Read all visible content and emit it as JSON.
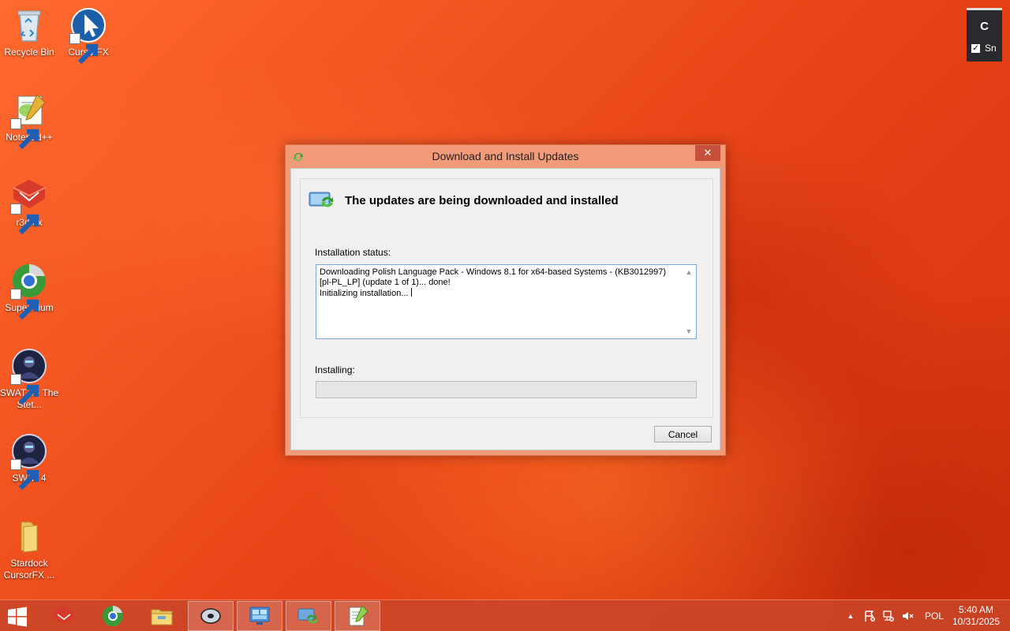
{
  "desktop": {
    "icons": [
      {
        "label": "Recycle Bin",
        "icon": "recycle-bin-icon"
      },
      {
        "label": "CursorFX",
        "icon": "cursorfx-icon"
      },
      {
        "label": "Notepad++",
        "icon": "notepadpp-icon"
      },
      {
        "label": "r3dfox",
        "icon": "r3dfox-icon"
      },
      {
        "label": "Supermium",
        "icon": "supermium-icon"
      },
      {
        "label": "SWAT 4 - The Stet...",
        "icon": "swat4-icon"
      },
      {
        "label": "SWAT 4",
        "icon": "swat4-icon"
      },
      {
        "label": "Stardock CursorFX ...",
        "icon": "folder-icon"
      }
    ]
  },
  "gadget": {
    "title": "C",
    "option_label": "Sn",
    "checked": true
  },
  "dialog": {
    "title": "Download and Install Updates",
    "close_glyph": "✕",
    "heading": "The updates are being downloaded and installed",
    "status_label": "Installation status:",
    "status_lines": [
      "Downloading Polish Language Pack - Windows 8.1 for x64-based Systems - (KB3012997) [pl-PL_LP] (update 1 of 1)... done!",
      "Initializing installation..."
    ],
    "installing_label": "Installing:",
    "progress_fraction": 0,
    "cancel_label": "Cancel"
  },
  "taskbar": {
    "buttons": [
      {
        "icon": "r3dfox-icon",
        "active": false
      },
      {
        "icon": "supermium-icon",
        "active": false
      },
      {
        "icon": "file-explorer-icon",
        "active": false
      },
      {
        "icon": "disk-icon",
        "active": true
      },
      {
        "icon": "control-panel-icon",
        "active": true
      },
      {
        "icon": "windows-update-icon",
        "active": true
      },
      {
        "icon": "notepadpp-icon",
        "active": true
      }
    ],
    "tray": {
      "language": "POL",
      "time": "5:40 AM",
      "date": "10/31/2025"
    }
  },
  "colors": {
    "wallpaper": "#e8421a",
    "dialog_frame": "#f39a78",
    "close_button": "#c7503a",
    "taskbar": "#c84628"
  }
}
